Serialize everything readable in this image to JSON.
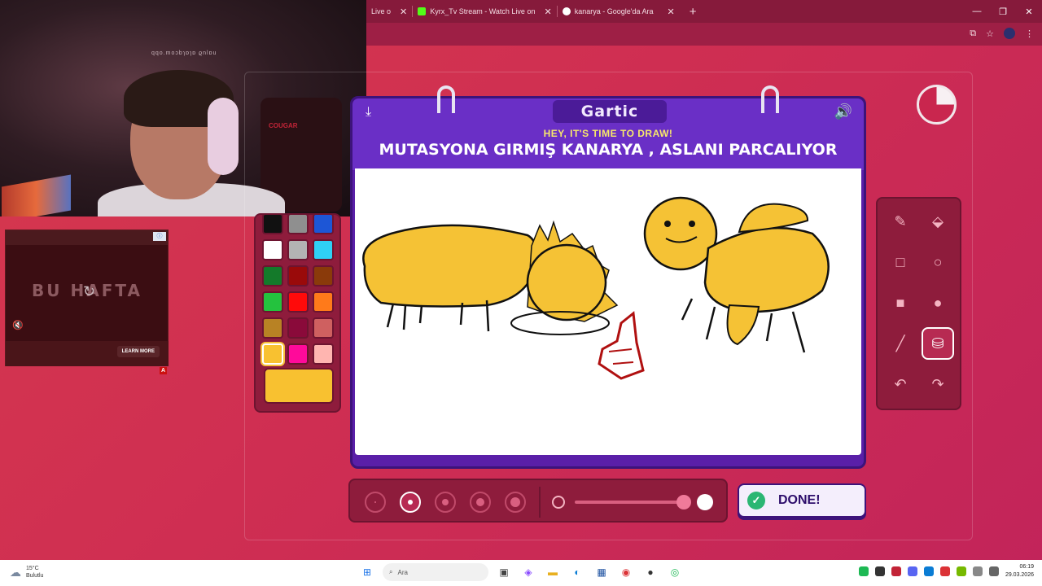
{
  "browser": {
    "tabs": [
      {
        "label": "Live o",
        "favicon_color": "#7a1a33"
      },
      {
        "label": "Kyrx_Tv Stream - Watch Live on",
        "favicon_color": "#53fc18"
      },
      {
        "label": "kanarya - Google'da Ara",
        "favicon_color": "#ffffff"
      }
    ],
    "new_tab_icon": "plus-icon",
    "window_controls": [
      "minimize-icon",
      "maximize-icon",
      "close-icon"
    ],
    "address_icons": [
      "translate-icon",
      "star-icon",
      "profile-icon",
      "menu-icon"
    ]
  },
  "webcam": {
    "wall_text": "qqo.moɔbɿɒɿɒ ϱnlɒu",
    "chair_text": "COUGAR"
  },
  "ad": {
    "headline": "BU HAFTA",
    "learn_more": "LEARN MORE",
    "badge": "ⓘ",
    "corner": "A",
    "mute_icon": "mute-icon",
    "replay_icon": "replay-icon"
  },
  "game": {
    "logo": "Gartic",
    "hint": "HEY, IT'S TIME TO DRAW!",
    "prompt": "MUTASYONA GIRMIŞ KANARYA , ASLANI PARCALIYOR",
    "done_label": "DONE!",
    "palette": {
      "colors": [
        [
          "#111111",
          "#8f8f8f",
          "#1d56d6"
        ],
        [
          "#ffffff",
          "#b3b3b3",
          "#2fd0f5"
        ],
        [
          "#147a2a",
          "#9a0a0a",
          "#8a3a0a"
        ],
        [
          "#24c23e",
          "#ff0a0a",
          "#ff7a1a"
        ],
        [
          "#b88224",
          "#8a0a3a",
          "#cf6060"
        ],
        [
          "#f8c130",
          "#ff0a9a",
          "#ffb5b0"
        ]
      ],
      "selected_color": "#f8c130"
    },
    "tools": [
      {
        "name": "pencil-icon",
        "glyph": "✎"
      },
      {
        "name": "eraser-icon",
        "glyph": "⬙"
      },
      {
        "name": "rectangle-outline-icon",
        "glyph": "□"
      },
      {
        "name": "ellipse-outline-icon",
        "glyph": "○"
      },
      {
        "name": "rectangle-filled-icon",
        "glyph": "■"
      },
      {
        "name": "ellipse-filled-icon",
        "glyph": "●"
      },
      {
        "name": "line-icon",
        "glyph": "╱"
      },
      {
        "name": "fill-bucket-icon",
        "glyph": "⛁"
      },
      {
        "name": "undo-icon",
        "glyph": "↶"
      },
      {
        "name": "redo-icon",
        "glyph": "↷"
      }
    ],
    "active_tool": "fill-bucket-icon",
    "brush_sizes": [
      "xs",
      "s",
      "m",
      "l",
      "xl"
    ],
    "active_brush_size": "s",
    "opacity_percent": 100,
    "timer_remaining_fraction": 0.75
  },
  "taskbar": {
    "weather_temp": "15°C",
    "weather_desc": "Bulutlu",
    "search_placeholder": "Ara",
    "time": "06:19",
    "date": "29.03.2026"
  }
}
